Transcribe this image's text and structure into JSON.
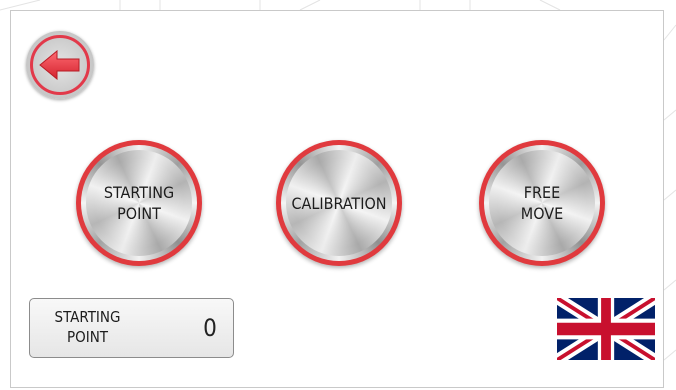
{
  "back_button": {
    "icon": "arrow-left-icon",
    "accent": "#e2394a"
  },
  "buttons": [
    {
      "label": "STARTING\nPOINT"
    },
    {
      "label": "CALIBRATION"
    },
    {
      "label": "FREE\nMOVE"
    }
  ],
  "counter": {
    "label": "STARTING\nPOINT",
    "value": "0"
  },
  "language": {
    "icon": "uk-flag-icon"
  },
  "colors": {
    "accent_red": "#e03a3e",
    "metal_light": "#f1f1f1",
    "metal_dark": "#a9a9a9"
  }
}
